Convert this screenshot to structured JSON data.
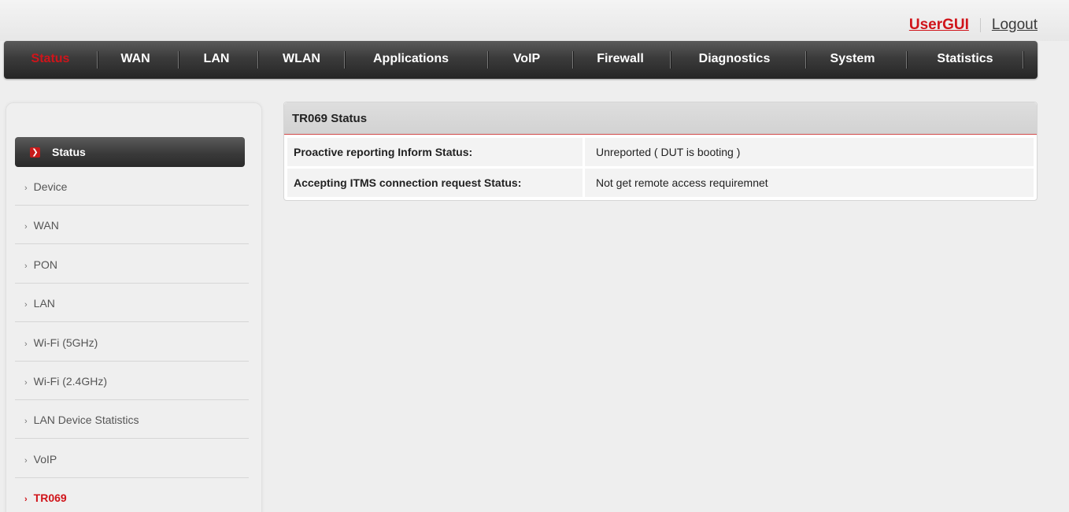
{
  "header": {
    "usergui_label": "UserGUI",
    "logout_label": "Logout"
  },
  "nav": {
    "items": [
      {
        "label": "Status",
        "active": true
      },
      {
        "label": "WAN"
      },
      {
        "label": "LAN"
      },
      {
        "label": "WLAN"
      },
      {
        "label": "Applications"
      },
      {
        "label": "VoIP"
      },
      {
        "label": "Firewall"
      },
      {
        "label": "Diagnostics"
      },
      {
        "label": "System"
      },
      {
        "label": "Statistics"
      }
    ]
  },
  "sidebar": {
    "section_label": "Status",
    "items": [
      {
        "label": "Device"
      },
      {
        "label": "WAN"
      },
      {
        "label": "PON"
      },
      {
        "label": "LAN"
      },
      {
        "label": "Wi-Fi (5GHz)"
      },
      {
        "label": "Wi-Fi (2.4GHz)"
      },
      {
        "label": "LAN Device Statistics"
      },
      {
        "label": "VoIP"
      },
      {
        "label": "TR069",
        "current": true
      }
    ]
  },
  "main": {
    "title": "TR069 Status",
    "rows": [
      {
        "label": "Proactive reporting Inform Status:",
        "value": "Unreported ( DUT is booting )"
      },
      {
        "label": "Accepting ITMS connection request Status:",
        "value": "Not get remote access requiremnet"
      }
    ]
  },
  "colors": {
    "accent_red": "#d0141a",
    "nav_dark": "#2f2f2f",
    "page_bg": "#eeeeee"
  },
  "icons": {
    "sidebar_active_arrow": "chevron-right-icon",
    "sidebar_bullet": "bullet-chevron-icon"
  }
}
